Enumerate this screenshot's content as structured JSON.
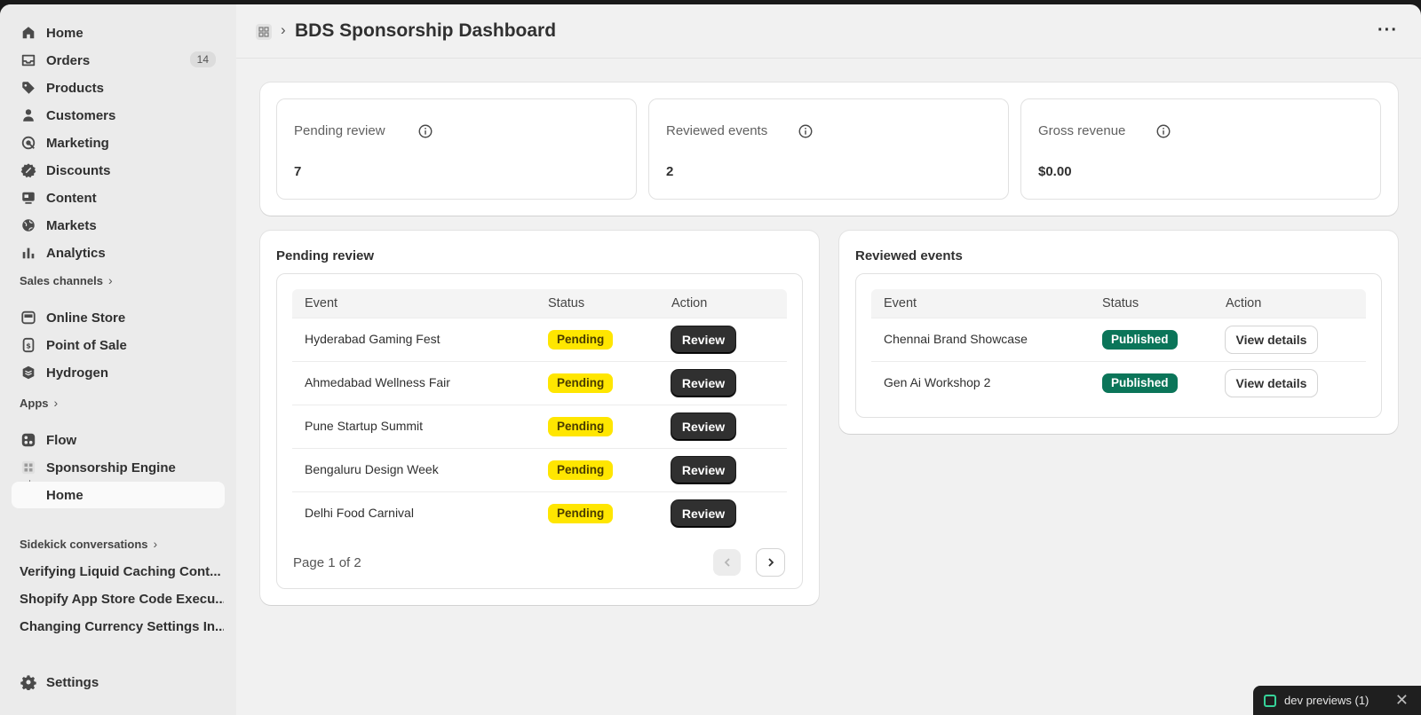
{
  "sidebar": {
    "nav": [
      {
        "label": "Home",
        "icon": "home-icon"
      },
      {
        "label": "Orders",
        "icon": "inbox-icon",
        "badge": "14"
      },
      {
        "label": "Products",
        "icon": "tag-icon"
      },
      {
        "label": "Customers",
        "icon": "person-icon"
      },
      {
        "label": "Marketing",
        "icon": "target-icon"
      },
      {
        "label": "Discounts",
        "icon": "discount-icon"
      },
      {
        "label": "Content",
        "icon": "content-icon"
      },
      {
        "label": "Markets",
        "icon": "globe-icon"
      },
      {
        "label": "Analytics",
        "icon": "bar-chart-icon"
      }
    ],
    "sales_channels_label": "Sales channels",
    "sales_channels": [
      {
        "label": "Online Store",
        "icon": "store-icon"
      },
      {
        "label": "Point of Sale",
        "icon": "pos-icon"
      },
      {
        "label": "Hydrogen",
        "icon": "hydrogen-icon"
      }
    ],
    "apps_label": "Apps",
    "apps": [
      {
        "label": "Flow",
        "icon": "flow-icon"
      },
      {
        "label": "Sponsorship Engine",
        "icon": "app-grid-icon"
      },
      {
        "label": "Home",
        "icon": ""
      }
    ],
    "sidekick_label": "Sidekick conversations",
    "conversations": [
      "Verifying Liquid Caching Cont...",
      "Shopify App Store Code Execu...",
      "Changing Currency Settings In..."
    ],
    "settings_label": "Settings"
  },
  "header": {
    "title": "BDS Sponsorship Dashboard",
    "separator": "›",
    "more": "···"
  },
  "metrics": [
    {
      "label": "Pending review",
      "value": "7"
    },
    {
      "label": "Reviewed events",
      "value": "2"
    },
    {
      "label": "Gross revenue",
      "value": "$0.00"
    }
  ],
  "pending": {
    "title": "Pending review",
    "columns": [
      "Event",
      "Status",
      "Action"
    ],
    "rows": [
      {
        "event": "Hyderabad Gaming Fest",
        "status": "Pending",
        "action": "Review"
      },
      {
        "event": "Ahmedabad Wellness Fair",
        "status": "Pending",
        "action": "Review"
      },
      {
        "event": "Pune Startup Summit",
        "status": "Pending",
        "action": "Review"
      },
      {
        "event": "Bengaluru Design Week",
        "status": "Pending",
        "action": "Review"
      },
      {
        "event": "Delhi Food Carnival",
        "status": "Pending",
        "action": "Review"
      }
    ],
    "pager": "Page 1 of 2"
  },
  "reviewed": {
    "title": "Reviewed events",
    "columns": [
      "Event",
      "Status",
      "Action"
    ],
    "rows": [
      {
        "event": "Chennai Brand Showcase",
        "status": "Published",
        "action": "View details"
      },
      {
        "event": "Gen Ai Workshop 2",
        "status": "Published",
        "action": "View details"
      }
    ]
  },
  "dev_bar": {
    "label": "dev previews",
    "count": "(1)",
    "close": "✕"
  },
  "colors": {
    "pending_pill": "#ffe600",
    "published_pill": "#0b7559",
    "primary_button": "#303030",
    "dev_icon": "#36d399"
  }
}
